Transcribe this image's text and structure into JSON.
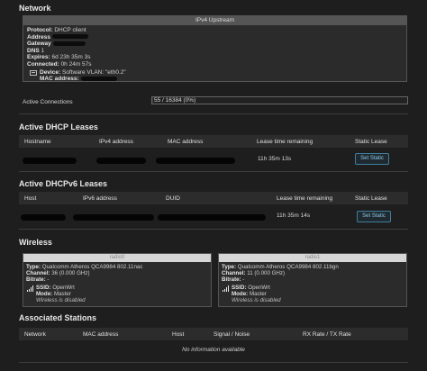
{
  "network": {
    "title": "Network",
    "upstream_header": "IPv4 Upstream",
    "protocol_label": "Protocol:",
    "protocol_value": "DHCP client",
    "address_label": "Address",
    "gateway_label": "Gateway",
    "dns_label": "DNS",
    "dns_value": "1",
    "expires_label": "Expires:",
    "expires_value": "6d 23h 35m 3s",
    "connected_label": "Connected:",
    "connected_value": "0h 24m 57s",
    "device_label": "Device:",
    "device_value": "Software VLAN: \"eth0.2\"",
    "mac_label": "MAC address:",
    "active_connections_label": "Active Connections",
    "active_connections_value": "55 / 16384 (0%)",
    "active_connections_fraction": 0.0034
  },
  "dhcp": {
    "title": "Active DHCP Leases",
    "headers": [
      "Hostname",
      "IPv4 address",
      "MAC address",
      "Lease time remaining",
      "Static Lease"
    ],
    "row_time": "11h 35m 13s",
    "button": "Set Static"
  },
  "dhcp6": {
    "title": "Active DHCPv6 Leases",
    "headers": [
      "Host",
      "IPv6 address",
      "DUID",
      "Lease time remaining",
      "Static Lease"
    ],
    "row_time": "11h 35m 14s",
    "button": "Set Static"
  },
  "wireless": {
    "title": "Wireless",
    "radios": [
      {
        "name": "radio0",
        "type_label": "Type:",
        "type_value": "Qualcomm Atheros QCA9984 802.11nac",
        "channel_label": "Channel:",
        "channel_value": "36 (0.000 GHz)",
        "bitrate_label": "Bitrate:",
        "bitrate_value": "-",
        "ssid_label": "SSID:",
        "ssid_value": "OpenWrt",
        "mode_label": "Mode:",
        "mode_value": "Master",
        "status": "Wireless is disabled"
      },
      {
        "name": "radio1",
        "type_label": "Type:",
        "type_value": "Qualcomm Atheros QCA9984 802.11bgn",
        "channel_label": "Channel:",
        "channel_value": "11 (0.000 GHz)",
        "bitrate_label": "Bitrate:",
        "bitrate_value": "-",
        "ssid_label": "SSID:",
        "ssid_value": "OpenWrt",
        "mode_label": "Mode:",
        "mode_value": "Master",
        "status": "Wireless is disabled"
      }
    ]
  },
  "associated": {
    "title": "Associated Stations",
    "headers": [
      "Network",
      "MAC address",
      "Host",
      "Signal / Noise",
      "RX Rate / TX Rate"
    ],
    "empty": "No information available"
  }
}
